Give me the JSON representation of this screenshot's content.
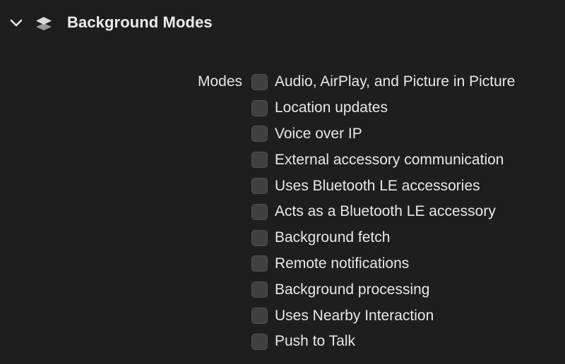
{
  "section": {
    "title": "Background Modes",
    "expanded": true,
    "icon": "chevron-down-icon",
    "capability_icon": "layers-icon"
  },
  "modes": {
    "label": "Modes",
    "items": [
      {
        "label": "Audio, AirPlay, and Picture in Picture",
        "checked": false
      },
      {
        "label": "Location updates",
        "checked": false
      },
      {
        "label": "Voice over IP",
        "checked": false
      },
      {
        "label": "External accessory communication",
        "checked": false
      },
      {
        "label": "Uses Bluetooth LE accessories",
        "checked": false
      },
      {
        "label": "Acts as a Bluetooth LE accessory",
        "checked": false
      },
      {
        "label": "Background fetch",
        "checked": false
      },
      {
        "label": "Remote notifications",
        "checked": false
      },
      {
        "label": "Background processing",
        "checked": false
      },
      {
        "label": "Uses Nearby Interaction",
        "checked": false
      },
      {
        "label": "Push to Talk",
        "checked": false
      }
    ]
  },
  "colors": {
    "background": "#1e1e1e",
    "checkbox_unchecked": "#404040",
    "checkbox_checked": "#2f7df6",
    "text": "#e8e8e8"
  }
}
